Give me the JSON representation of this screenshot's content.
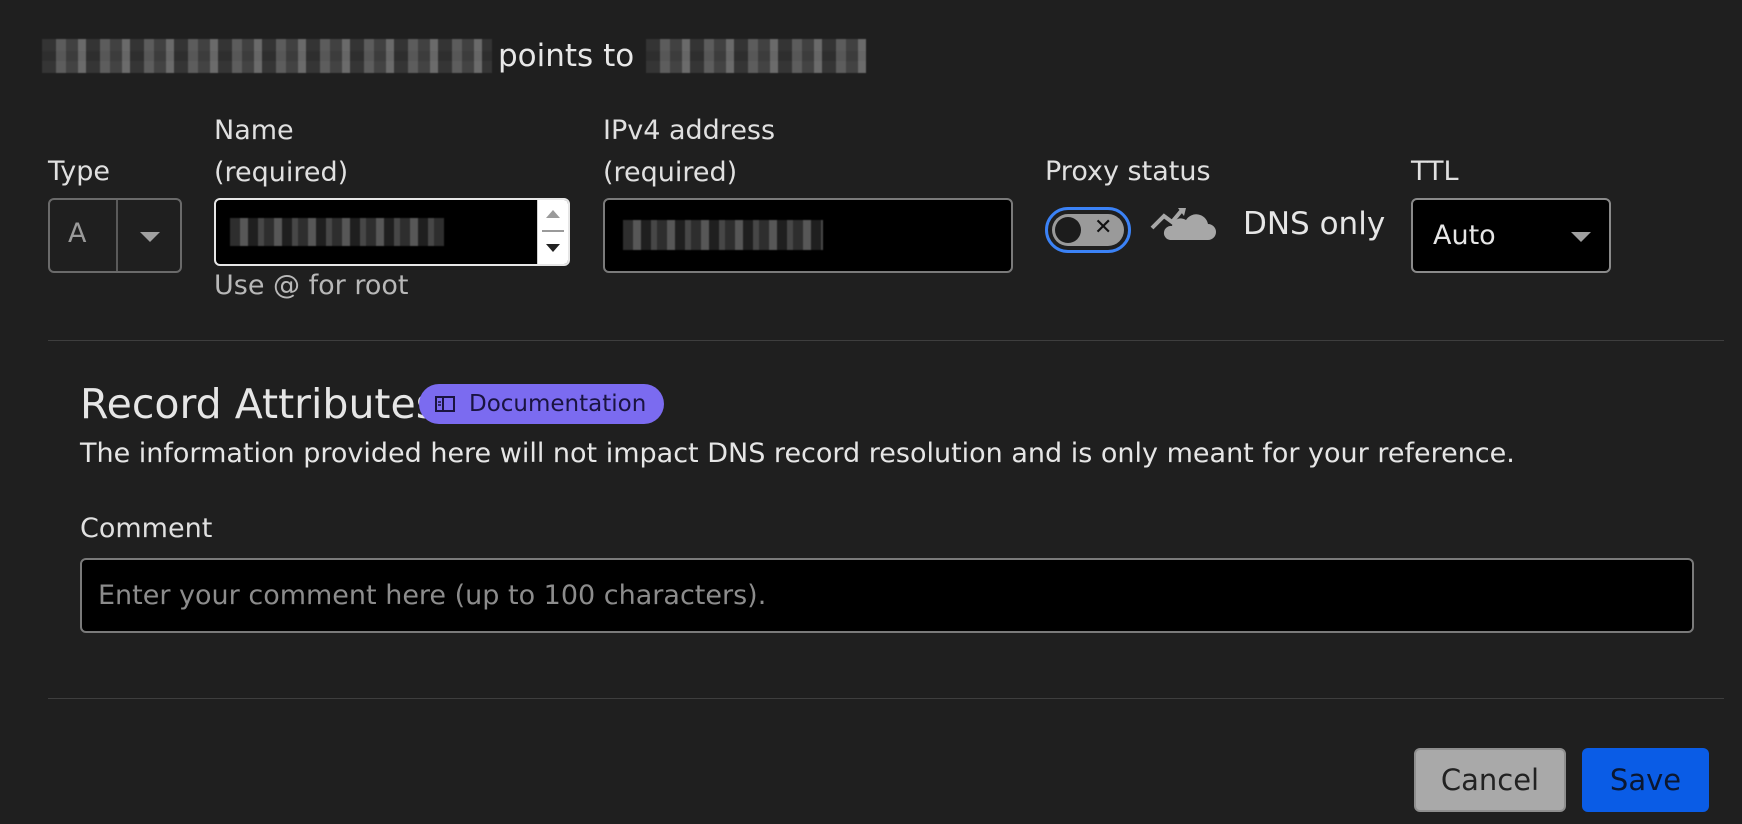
{
  "summary": {
    "points_to_text": "points to"
  },
  "form": {
    "type": {
      "label": "Type",
      "value": "A"
    },
    "name": {
      "label_line1": "Name",
      "label_line2": "(required)",
      "hint": "Use @ for root"
    },
    "ipv4": {
      "label_line1": "IPv4 address",
      "label_line2": "(required)"
    },
    "proxy": {
      "label": "Proxy status",
      "state_text": "DNS only",
      "enabled": false
    },
    "ttl": {
      "label": "TTL",
      "value": "Auto"
    }
  },
  "record_attributes": {
    "title": "Record Attributes",
    "doc_badge": "Documentation",
    "description": "The information provided here will not impact DNS record resolution and is only meant for your reference.",
    "comment_label": "Comment",
    "comment_placeholder": "Enter your comment here (up to 100 characters)."
  },
  "actions": {
    "cancel": "Cancel",
    "save": "Save"
  },
  "colors": {
    "background": "#1f1f1f",
    "accent_blue": "#0a5ce6",
    "badge_purple": "#7b6bf0",
    "focus_ring": "#3b82f6"
  }
}
